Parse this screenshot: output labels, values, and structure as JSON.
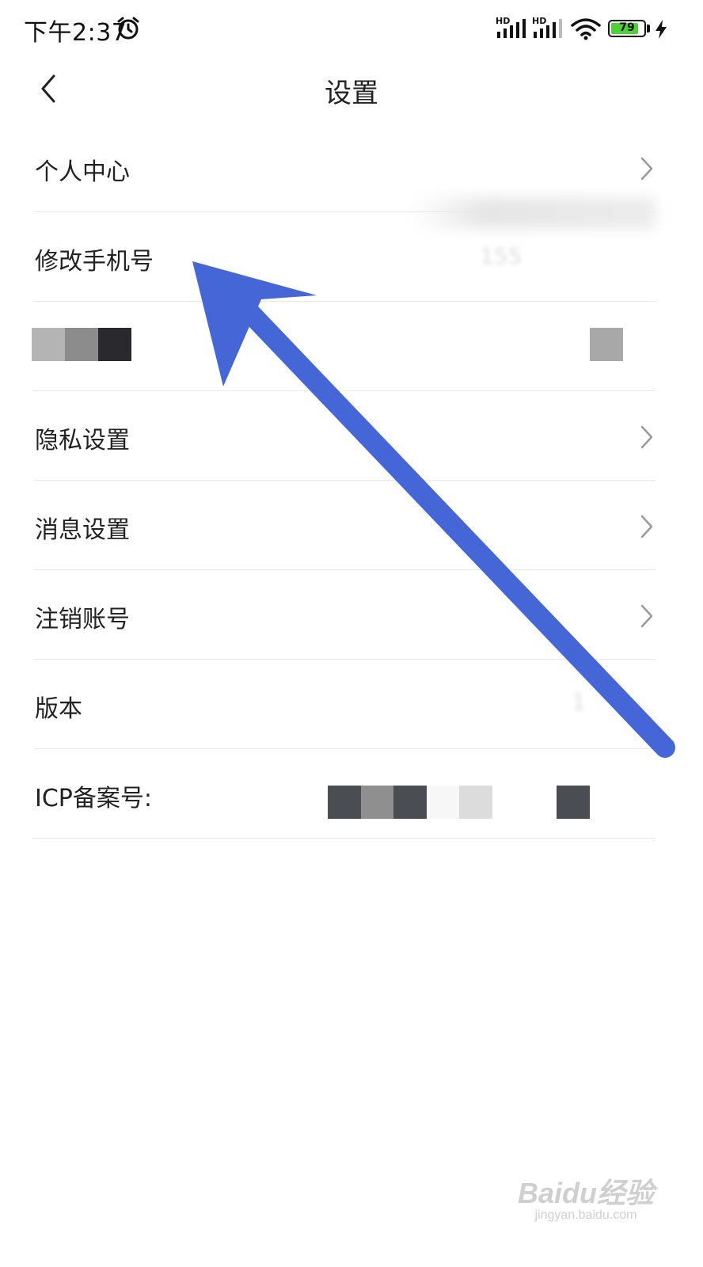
{
  "status_bar": {
    "time": "下午2:37",
    "signal_1_label": "HD",
    "signal_2_label": "HD",
    "battery_level": "79"
  },
  "nav": {
    "title": "设置"
  },
  "settings": {
    "items": [
      {
        "label": "个人中心",
        "value": "",
        "has_chevron": true
      },
      {
        "label": "修改手机号",
        "value": "155",
        "has_chevron": false
      },
      {
        "label": "",
        "value": "",
        "has_chevron": false
      },
      {
        "label": "隐私设置",
        "value": "",
        "has_chevron": true
      },
      {
        "label": "消息设置",
        "value": "",
        "has_chevron": true
      },
      {
        "label": "注销账号",
        "value": "",
        "has_chevron": true
      },
      {
        "label": "版本",
        "value": "1",
        "has_chevron": false
      },
      {
        "label": "ICP备案号:",
        "value": "",
        "has_chevron": false
      }
    ]
  },
  "annotation": {
    "arrow_color": "#4466d6"
  },
  "watermark": {
    "main": "Baidu经验",
    "sub": "jingyan.baidu.com"
  },
  "colors": {
    "background": "#ffffff",
    "divider": "#e8e8e8",
    "text": "#222222",
    "chevron": "#999999",
    "battery_fill": "#4cd137"
  }
}
